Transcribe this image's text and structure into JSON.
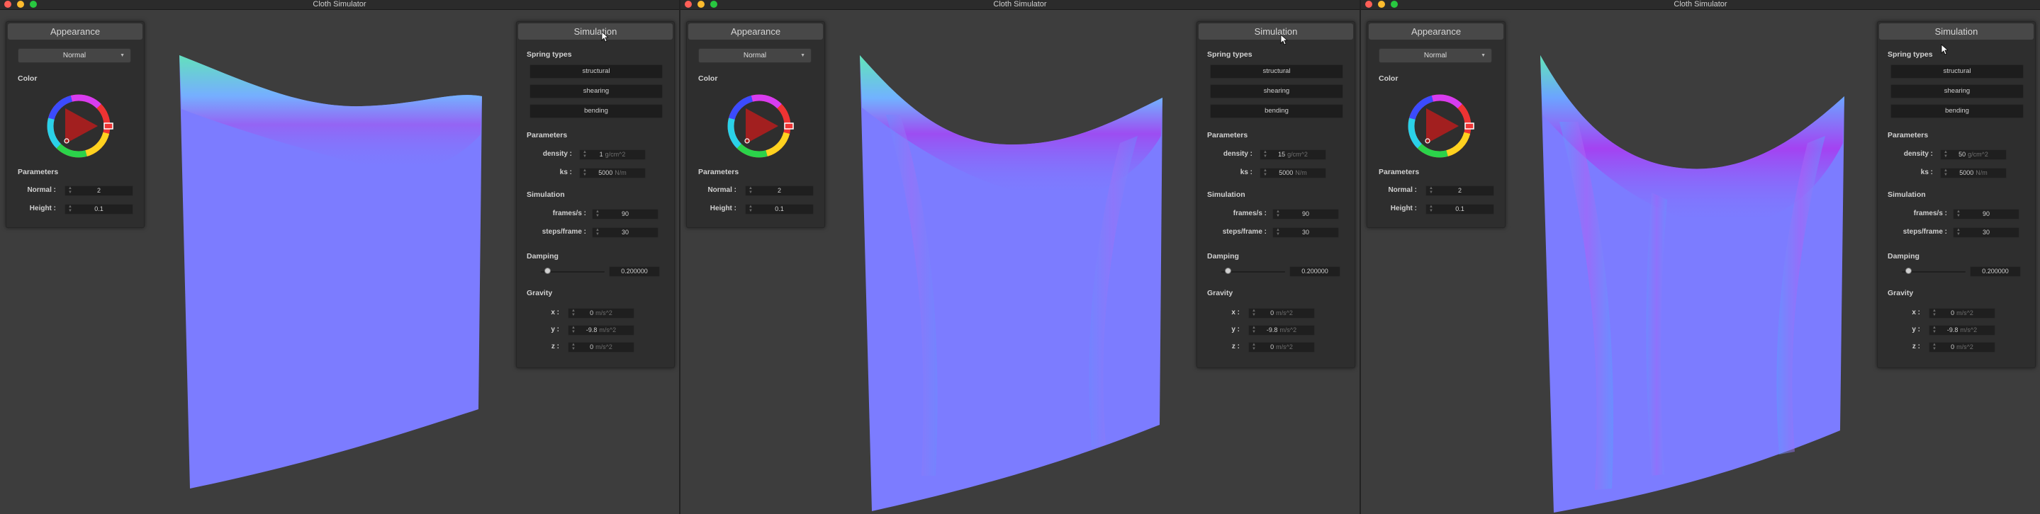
{
  "window_title": "Cloth Simulator",
  "appearance": {
    "title": "Appearance",
    "shader_select": "Normal",
    "color_label": "Color",
    "parameters_label": "Parameters",
    "normal_label": "Normal :",
    "normal_value": "2",
    "height_label": "Height :",
    "height_value": "0.1"
  },
  "simulation": {
    "title": "Simulation",
    "spring_types_label": "Spring types",
    "spring_types": [
      "structural",
      "shearing",
      "bending"
    ],
    "parameters_label": "Parameters",
    "density_label": "density :",
    "density_unit": "g/cm^2",
    "ks_label": "ks :",
    "ks_value": "5000",
    "ks_unit": "N/m",
    "simulation_label": "Simulation",
    "fps_label": "frames/s :",
    "fps_value": "90",
    "steps_label": "steps/frame :",
    "steps_value": "30",
    "damping_label": "Damping",
    "damping_value": "0.200000",
    "gravity_label": "Gravity",
    "gx_label": "x :",
    "gx_value": "0",
    "gy_label": "y :",
    "gy_value": "-9.8",
    "gz_label": "z :",
    "gz_value": "0",
    "gravity_unit": "m/s^2"
  },
  "windows": [
    {
      "density_value": "1"
    },
    {
      "density_value": "15"
    },
    {
      "density_value": "50"
    }
  ],
  "colors": {
    "panel_bg": "#2e2e2e",
    "viewport_bg": "#3d3d3d",
    "cloth_base": "#7c7cff",
    "cloth_fold": "#9a58f2",
    "cloth_top": "#5ef2b0"
  }
}
